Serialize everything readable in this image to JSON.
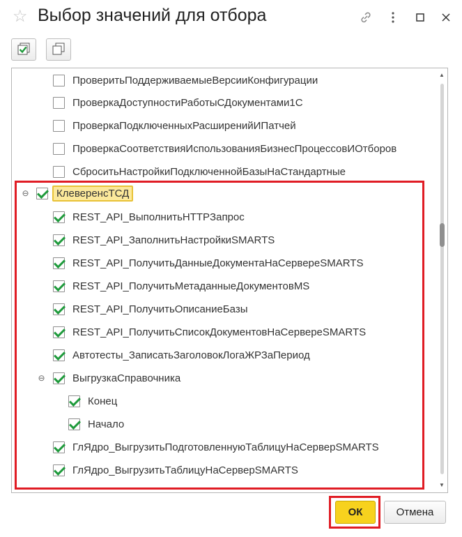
{
  "window": {
    "title": "Выбор значений для отбора"
  },
  "toolbar": {
    "check_all_icon": "check-all-icon",
    "uncheck_all_icon": "uncheck-all-icon"
  },
  "list": {
    "rows": [
      {
        "label": "ПроверитьПоддерживаемыеВерсииКонфигурации",
        "checked": false
      },
      {
        "label": "ПроверкаДоступностиРаботыСДокументами1С",
        "checked": false
      },
      {
        "label": "ПроверкаПодключенныхРасширенийИПатчей",
        "checked": false
      },
      {
        "label": "ПроверкаСоответствияИспользованияБизнесПроцессовИОтборов",
        "checked": false
      },
      {
        "label": "СброситьНастройкиПодключеннойБазыНаСтандартные",
        "checked": false
      },
      {
        "label": "КлеверенсТСД",
        "checked": true
      },
      {
        "label": "REST_API_ВыполнитьHTTPЗапрос",
        "checked": true
      },
      {
        "label": "REST_API_ЗаполнитьНастройкиSMARTS",
        "checked": true
      },
      {
        "label": "REST_API_ПолучитьДанныеДокументаНаСервереSMARTS",
        "checked": true
      },
      {
        "label": "REST_API_ПолучитьМетаданныеДокументовMS",
        "checked": true
      },
      {
        "label": "REST_API_ПолучитьОписаниеБазы",
        "checked": true
      },
      {
        "label": "REST_API_ПолучитьСписокДокументовНаСервереSMARTS",
        "checked": true
      },
      {
        "label": "Автотесты_ЗаписатьЗаголовокЛогаЖРЗаПериод",
        "checked": true
      },
      {
        "label": "ВыгрузкаСправочника",
        "checked": true
      },
      {
        "label": "Конец",
        "checked": true
      },
      {
        "label": "Начало",
        "checked": true
      },
      {
        "label": "ГлЯдро_ВыгрузитьПодготовленнуюТаблицуНаСерверSMARTS",
        "checked": true
      },
      {
        "label": "ГлЯдро_ВыгрузитьТаблицуНаСерверSMARTS",
        "checked": true
      }
    ],
    "toggle_symbol": "⊖"
  },
  "scroll": {
    "position_fraction": 0.4
  },
  "buttons": {
    "ok": "ОК",
    "cancel": "Отмена"
  },
  "colors": {
    "check": "#1e9a3b",
    "ok_button": "#f7d21e",
    "highlight": "#e01c24",
    "selected_label": "#fce99b"
  }
}
